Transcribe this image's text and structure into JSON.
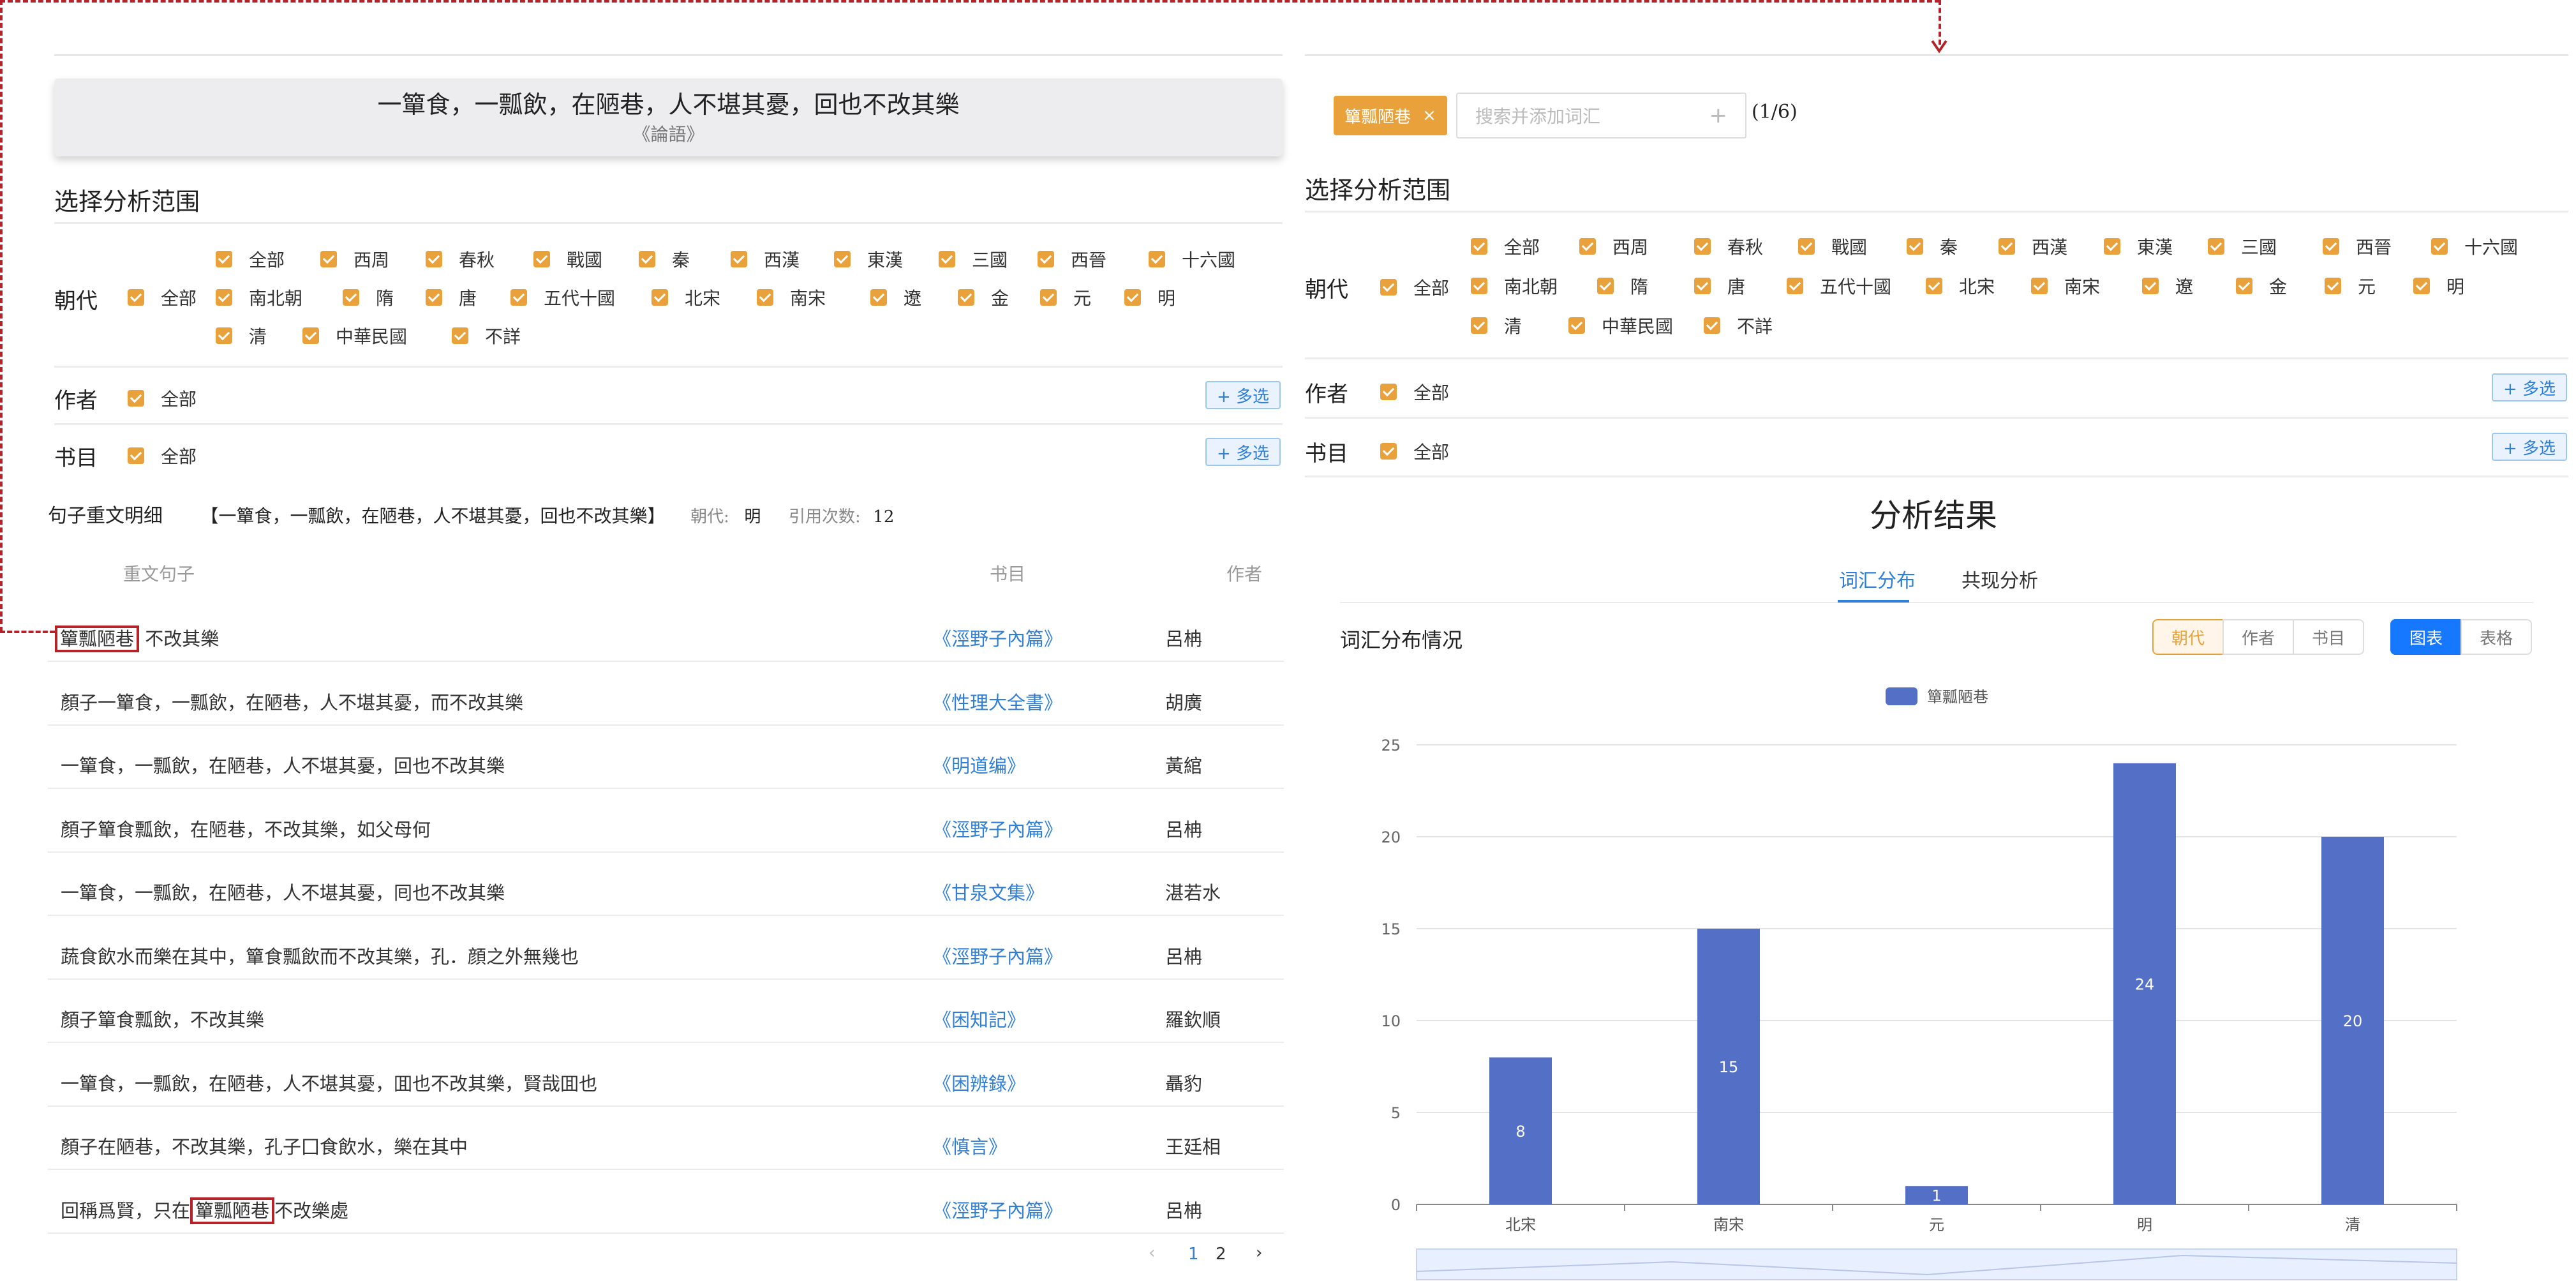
{
  "quote": {
    "text": "一簞食，一瓢飲，在陋巷，人不堪其憂，回也不改其樂",
    "source": "《論語》"
  },
  "scope_title": "选择分析范围",
  "dynasty_label": "朝代",
  "author_label": "作者",
  "book_label": "书目",
  "all_label": "全部",
  "multi_label": "+ 多选",
  "dynasties": [
    "全部",
    "西周",
    "春秋",
    "戰國",
    "秦",
    "西漢",
    "東漢",
    "三國",
    "西晉",
    "十六國",
    "南北朝",
    "隋",
    "唐",
    "五代十國",
    "北宋",
    "南宋",
    "遼",
    "金",
    "元",
    "明",
    "清",
    "中華民國",
    "不詳"
  ],
  "detail": {
    "title": "句子重文明细",
    "sentence": "【一簞食，一瓢飲，在陋巷，人不堪其憂，回也不改其樂】",
    "dynasty_key": "朝代:",
    "dynasty_val": "明",
    "count_key": "引用次数:",
    "count_val": "12",
    "col_sentence": "重文句子",
    "col_book": "书目",
    "col_author": "作者",
    "rows": [
      {
        "pre": "",
        "hl": "簞瓢陋巷",
        "post": " 不改其樂",
        "book": "《涇野子內篇》",
        "author": "呂柟"
      },
      {
        "pre": "顏子一簞食，一瓢飲，在陋巷，人不堪其憂，而不改其樂",
        "hl": "",
        "post": "",
        "book": "《性理大全書》",
        "author": "胡廣"
      },
      {
        "pre": "一簞食，一瓢飲，在陋巷，人不堪其憂，回也不改其樂",
        "hl": "",
        "post": "",
        "book": "《明道编》",
        "author": "黃綰"
      },
      {
        "pre": "顏子簞食瓢飲，在陋巷，不改其樂，如父母何",
        "hl": "",
        "post": "",
        "book": "《涇野子內篇》",
        "author": "呂柟"
      },
      {
        "pre": "一簞食，一瓢飲，在陋巷，人不堪其憂，囘也不改其樂",
        "hl": "",
        "post": "",
        "book": "《甘泉文集》",
        "author": "湛若水"
      },
      {
        "pre": "蔬食飲水而樂在其中，簞食瓢飲而不改其樂，孔．顔之外無幾也",
        "hl": "",
        "post": "",
        "book": "《涇野子內篇》",
        "author": "呂柟"
      },
      {
        "pre": "顏子簞食瓢飲，不改其樂",
        "hl": "",
        "post": "",
        "book": "《困知記》",
        "author": "羅欽順"
      },
      {
        "pre": "一簞食，一瓢飲，在陋巷，人不堪其憂，囬也不改其樂，賢哉囬也",
        "hl": "",
        "post": "",
        "book": "《困辨錄》",
        "author": "聶豹"
      },
      {
        "pre": "顏子在陋巷，不改其樂，孔子囗食飲水，樂在其中",
        "hl": "",
        "post": "",
        "book": "《慎言》",
        "author": "王廷相"
      },
      {
        "pre": "回稱爲賢，只在",
        "hl": "簞瓢陋巷",
        "post": "不改樂處",
        "book": "《涇野子內篇》",
        "author": "呂柟"
      }
    ]
  },
  "pager": {
    "prev": "‹",
    "p1": "1",
    "p2": "2",
    "next": "›"
  },
  "right": {
    "tag_label": "簞瓢陋巷",
    "tag_close": "×",
    "search_placeholder": "搜索并添加词汇",
    "search_plus": "+",
    "count": "(1/6)",
    "result_title": "分析结果",
    "tab_vocab": "词汇分布",
    "tab_co": "共现分析",
    "dist_title": "词汇分布情况",
    "group1": [
      "朝代",
      "作者",
      "书目"
    ],
    "group2": [
      "图表",
      "表格"
    ]
  },
  "colors": {
    "accent_orange": "#e9a23b",
    "link_blue": "#2f7fd6",
    "bar_blue": "#5470c6",
    "highlight_red": "#b4232a"
  },
  "chart_data": {
    "type": "bar",
    "categories": [
      "北宋",
      "南宋",
      "元",
      "明",
      "清"
    ],
    "series": [
      {
        "name": "簞瓢陋巷",
        "values": [
          8,
          15,
          1,
          24,
          20
        ]
      }
    ],
    "ylim": [
      0,
      25
    ],
    "yticks": [
      0,
      5,
      10,
      15,
      20,
      25
    ],
    "legend": "top-center",
    "grid": true,
    "data_labels": true
  }
}
